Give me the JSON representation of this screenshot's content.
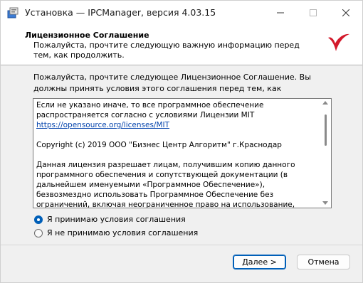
{
  "window": {
    "title": "Установка — IPCManager, версия 4.03.15"
  },
  "header": {
    "title": "Лицензионное Соглашение",
    "subtitle": "Пожалуйста, прочтите следующую важную информацию перед тем, как продолжить."
  },
  "instructions": "Пожалуйста, прочтите следующее Лицензионное Соглашение. Вы должны принять условия этого соглашения перед тем, как продолжить.",
  "license": {
    "para1_text": "Если не указано иначе, то все программное обеспечение распространяется согласно с условиями Лицензии MIT ",
    "para1_link": "https://opensource.org/licenses/MIT",
    "para2": "Copyright (c) 2019 ООО \"Бизнес Центр Алгоритм\" г.Краснодар",
    "para3": "Данная лицензия разрешает лицам, получившим копию данного программного обеспечения и сопутствующей документации (в дальнейшем именуемыми «Программное Обеспечение»), безвозмездно использовать Программное Обеспечение без ограничений, включая неограниченное право на использование, копирование, изменение, слияние, публикацию, распространение, сублицензирование и/или продажу копий Программного"
  },
  "radios": {
    "accept_label": "Я принимаю условия соглашения",
    "decline_label": "Я не принимаю условия соглашения",
    "selected": "accept"
  },
  "buttons": {
    "next": "Далее >",
    "cancel": "Отмена"
  },
  "colors": {
    "accent": "#005fb8",
    "link": "#0645ad",
    "logo": "#d3192b"
  }
}
